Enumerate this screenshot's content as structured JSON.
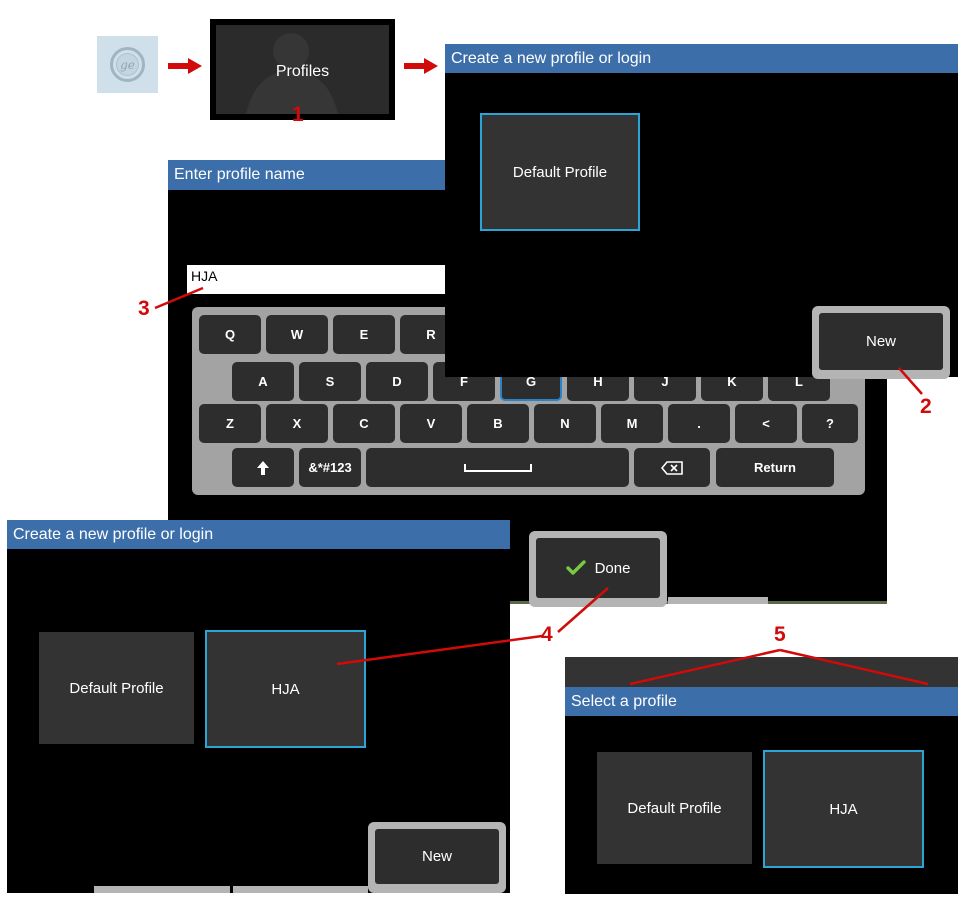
{
  "step1": {
    "profiles_label": "Profiles",
    "marker": "1"
  },
  "panel_create_top": {
    "title": "Create a new profile or login",
    "default_profile": "Default Profile",
    "new_label": "New",
    "marker": "2"
  },
  "panel_enter_name": {
    "title": "Enter profile name",
    "input_value": "HJA",
    "marker": "3",
    "keyboard": {
      "row1": [
        "Q",
        "W",
        "E",
        "R"
      ],
      "row2": [
        "A",
        "S",
        "D",
        "F",
        "G",
        "H",
        "J",
        "K",
        "L"
      ],
      "row3": [
        "Z",
        "X",
        "C",
        "V",
        "B",
        "N",
        "M",
        ".",
        "<",
        "?"
      ],
      "symbols_label": "&*#123",
      "return_label": "Return"
    },
    "done_label": "Done"
  },
  "panel_create_bottom": {
    "title": "Create a new profile or login",
    "default_profile": "Default Profile",
    "new_profile": "HJA",
    "new_label": "New",
    "marker": "4"
  },
  "panel_select": {
    "title": "Select a profile",
    "default_profile": "Default Profile",
    "selected_profile": "HJA",
    "marker": "5"
  },
  "colors": {
    "title_bar": "#3c6fa9",
    "selection_border": "#2aa6d6",
    "annotation": "#d10a0a",
    "check": "#7ac943"
  },
  "icons": [
    "ge-logo-icon",
    "right-arrow-icon",
    "shift-arrow-icon",
    "spacebar-icon",
    "backspace-icon",
    "checkmark-icon"
  ]
}
